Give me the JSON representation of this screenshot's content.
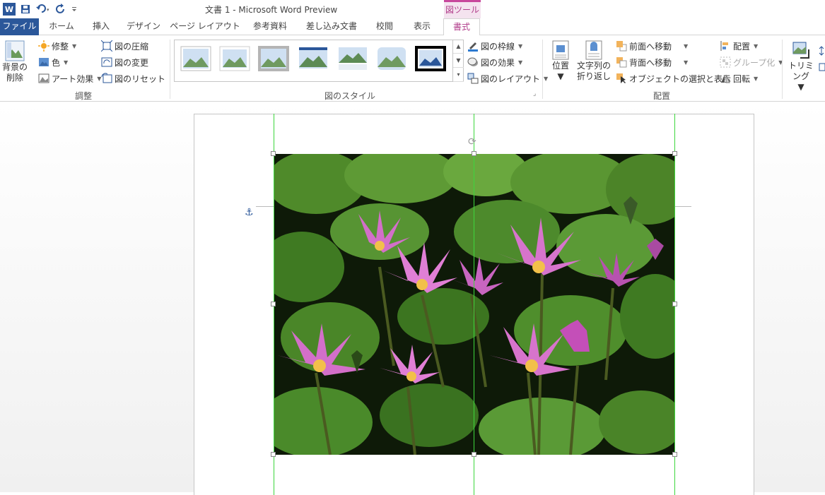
{
  "app": {
    "title": "文書 1 - Microsoft Word Preview",
    "context_tab_group": "図ツール"
  },
  "tabs": [
    {
      "label": "ファイル"
    },
    {
      "label": "ホーム"
    },
    {
      "label": "挿入"
    },
    {
      "label": "デザイン"
    },
    {
      "label": "ページ レイアウト"
    },
    {
      "label": "参考資料"
    },
    {
      "label": "差し込み文書"
    },
    {
      "label": "校閲"
    },
    {
      "label": "表示"
    },
    {
      "label": "書式"
    }
  ],
  "ribbon": {
    "adjust": {
      "remove_bg_line1": "背景の",
      "remove_bg_line2": "削除",
      "corrections": "修整",
      "color": "色",
      "artistic": "アート効果",
      "compress": "図の圧縮",
      "change": "図の変更",
      "reset": "図のリセット",
      "group_label": "調整"
    },
    "styles": {
      "border": "図の枠線",
      "effects": "図の効果",
      "layout": "図のレイアウト",
      "group_label": "図のスタイル"
    },
    "arrange": {
      "position": "位置",
      "wrap_line1": "文字列の",
      "wrap_line2": "折り返し",
      "bring_forward": "前面へ移動",
      "send_backward": "背面へ移動",
      "selection_pane": "オブジェクトの選択と表示",
      "align": "配置",
      "group": "グループ化",
      "rotate": "回転",
      "group_label": "配置"
    },
    "size": {
      "crop": "トリミング"
    }
  },
  "colors": {
    "file_tab": "#2b579a",
    "context_accent": "#b13d8b",
    "guide": "#3dd63d"
  }
}
